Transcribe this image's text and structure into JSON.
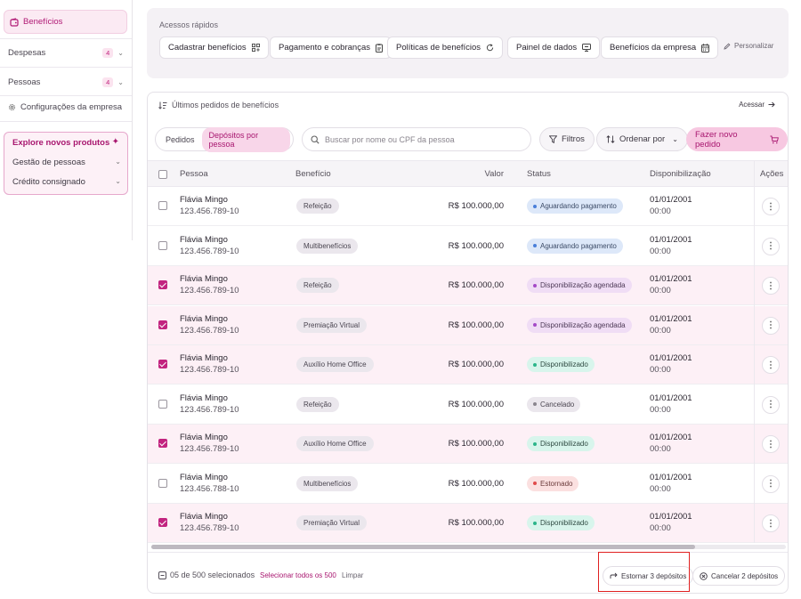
{
  "sidebar": {
    "active": {
      "label": "Benefícios",
      "icon": "wallet-icon"
    },
    "items": [
      {
        "label": "Despesas",
        "badge": "4"
      },
      {
        "label": "Pessoas",
        "badge": "4"
      }
    ],
    "config": {
      "label": "Configurações da empresa",
      "icon": "gear-icon"
    },
    "explore": {
      "title": "Explore novos produtos",
      "icon": "sparkle-icon",
      "items": [
        "Gestão de pessoas",
        "Crédito consignado"
      ]
    }
  },
  "quick_access": {
    "label": "Acessos rápidos",
    "buttons": [
      {
        "label": "Cadastrar benefícios",
        "icon": "grid-plus-icon"
      },
      {
        "label": "Pagamento e cobranças",
        "icon": "receipt-icon"
      },
      {
        "label": "Políticas de benefícios",
        "icon": "refresh-icon"
      },
      {
        "label": "Painel de dados",
        "icon": "monitor-icon"
      },
      {
        "label": "Benefícios da empresa",
        "icon": "calendar-icon"
      }
    ],
    "personalize": "Personalizar"
  },
  "orders": {
    "title": "Últimos pedidos de benefícios",
    "access": "Acessar",
    "tabs": [
      "Pedidos",
      "Depósitos por pessoa"
    ],
    "active_tab": "Depósitos por pessoa",
    "search_placeholder": "Buscar por nome ou CPF da pessoa",
    "filters": "Filtros",
    "sort": "Ordenar por",
    "new_order": "Fazer novo pedido",
    "columns": [
      "Pessoa",
      "Benefício",
      "Valor",
      "Status",
      "Disponibilização",
      "Ações"
    ],
    "rows": [
      {
        "name": "Flávia Mingo",
        "doc": "123.456.789-10",
        "benefit": "Refeição",
        "value": "R$ 100.000,00",
        "status": "Aguardando pagamento",
        "status_color": "blue",
        "date": "01/01/2001",
        "time": "00:00",
        "checked": false
      },
      {
        "name": "Flávia Mingo",
        "doc": "123.456.789-10",
        "benefit": "Multibenefícios",
        "value": "R$ 100.000,00",
        "status": "Aguardando pagamento",
        "status_color": "blue",
        "date": "01/01/2001",
        "time": "00:00",
        "checked": false
      },
      {
        "name": "Flávia Mingo",
        "doc": "123.456.789-10",
        "benefit": "Refeição",
        "value": "R$ 100.000,00",
        "status": "Disponibilização agendada",
        "status_color": "purple",
        "date": "01/01/2001",
        "time": "00:00",
        "checked": true
      },
      {
        "name": "Flávia Mingo",
        "doc": "123.456.789-10",
        "benefit": "Premiação Virtual",
        "value": "R$ 100.000,00",
        "status": "Disponibilização agendada",
        "status_color": "purple",
        "date": "01/01/2001",
        "time": "00:00",
        "checked": true
      },
      {
        "name": "Flávia Mingo",
        "doc": "123.456.789-10",
        "benefit": "Auxílio Home Office",
        "value": "R$ 100.000,00",
        "status": "Disponibilizado",
        "status_color": "green",
        "date": "01/01/2001",
        "time": "00:00",
        "checked": true
      },
      {
        "name": "Flávia Mingo",
        "doc": "123.456.789-10",
        "benefit": "Refeição",
        "value": "R$ 100.000,00",
        "status": "Cancelado",
        "status_color": "gray",
        "date": "01/01/2001",
        "time": "00:00",
        "checked": false
      },
      {
        "name": "Flávia Mingo",
        "doc": "123.456.789-10",
        "benefit": "Auxílio Home Office",
        "value": "R$ 100.000,00",
        "status": "Disponibilizado",
        "status_color": "green",
        "date": "01/01/2001",
        "time": "00:00",
        "checked": true
      },
      {
        "name": "Flávia Mingo",
        "doc": "123.456.788-10",
        "benefit": "Multibenefícios",
        "value": "R$ 100.000,00",
        "status": "Estornado",
        "status_color": "red",
        "date": "01/01/2001",
        "time": "00:00",
        "checked": false
      },
      {
        "name": "Flávia Mingo",
        "doc": "123.456.789-10",
        "benefit": "Premiação Virtual",
        "value": "R$ 100.000,00",
        "status": "Disponibilizado",
        "status_color": "green",
        "date": "01/01/2001",
        "time": "00:00",
        "checked": true
      }
    ],
    "footer": {
      "selected": "05 de 500 selecionados",
      "select_all": "Selecionar todos os 500",
      "clear": "Limpar",
      "reverse": "Estornar 3 depósitos",
      "cancel": "Cancelar 2 depósitos"
    }
  },
  "colors": {
    "accent": "#c2247f",
    "highlight_box": "#e02020"
  }
}
